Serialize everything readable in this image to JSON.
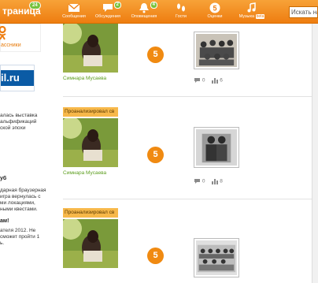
{
  "header": {
    "brand": "траница",
    "brand_badge": "24",
    "nav": [
      {
        "label": "Сообщения",
        "icon": "envelope-icon",
        "badge": ""
      },
      {
        "label": "Обсуждения",
        "icon": "chat-bubble-icon",
        "badge": "2"
      },
      {
        "label": "Оповещения",
        "icon": "bell-icon",
        "badge": "4"
      },
      {
        "label": "Гости",
        "icon": "footprints-icon",
        "badge": ""
      },
      {
        "label": "Оценки",
        "icon": "grade-5-icon",
        "badge": ""
      },
      {
        "label": "Музыка",
        "icon": "music-note-icon",
        "badge": "",
        "beta": "beta"
      }
    ],
    "search_placeholder": "Искать на"
  },
  "sidebar": {
    "ok_link": "ассники",
    "mail_logo": "il.ru",
    "lines": [
      {
        "text": "алась выставка",
        "bold": false
      },
      {
        "text": "альфификаций",
        "bold": false
      },
      {
        "text": "ской эпохи",
        "bold": false
      },
      {
        "text": "уб",
        "bold": true
      },
      {
        "text": "дарная браузерная",
        "bold": false
      },
      {
        "text": "игра вернулась с",
        "bold": false
      },
      {
        "text": "ми локациями,",
        "bold": false
      },
      {
        "text": "ными квестами.",
        "bold": false
      },
      {
        "text": "ам!",
        "bold": true
      },
      {
        "text": "ателя 2012. Не",
        "bold": false
      },
      {
        "text": "сможет пройти 1",
        "bold": false
      },
      {
        "text": "ь.",
        "bold": false
      }
    ]
  },
  "feed": [
    {
      "tag": "",
      "name": "Симнара Мусаева",
      "grade": "5",
      "comments": "0",
      "views": "6"
    },
    {
      "tag": "Проанализировал св",
      "name": "Симнара Мусаева",
      "grade": "5",
      "comments": "0",
      "views": "8"
    },
    {
      "tag": "Проанализировал св",
      "name": "",
      "grade": "5",
      "comments": "",
      "views": ""
    }
  ],
  "colors": {
    "accent": "#ee7d10",
    "badge": "#77c13b",
    "grade": "#f08a11",
    "name": "#5c9e1e"
  }
}
